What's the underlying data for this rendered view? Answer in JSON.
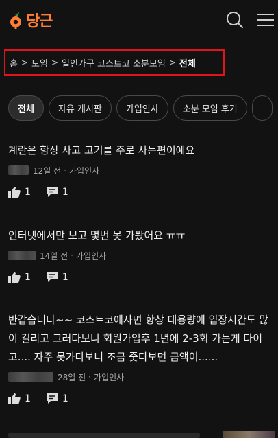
{
  "header": {
    "logo_text": "당근",
    "logo_color": "#ff7e36"
  },
  "breadcrumb": {
    "items": [
      "홈",
      "모임",
      "일인가구 코스트코 소분모임",
      "전체"
    ],
    "highlight_color": "#e0141c"
  },
  "tabs": [
    "전체",
    "자유 게시판",
    "가입인사",
    "소분 모임 후기"
  ],
  "posts": [
    {
      "title": "계란은 항상 사고 고기를 주로 사는편이예요",
      "time": "12일 전",
      "board": "가입인사",
      "likes": "1",
      "comments": "1"
    },
    {
      "title": "인터넷에서만 보고 몇번 못 가봤어요 ㅠㅠ",
      "time": "14일 전",
      "board": "가입인사",
      "likes": "1",
      "comments": "1"
    },
    {
      "title": "반갑습니다~~ 코스트코에사면 항상 대용량에 입장시간도 많이 걸리고 그러다보니 회원가입후 1년에 2-3회 가는게 다이고.... 자주 못가다보니 조금 줏다보면 금액이......",
      "time": "28일 전",
      "board": "가입인사",
      "likes": "1",
      "comments": "1"
    }
  ],
  "meta_separator": "·"
}
